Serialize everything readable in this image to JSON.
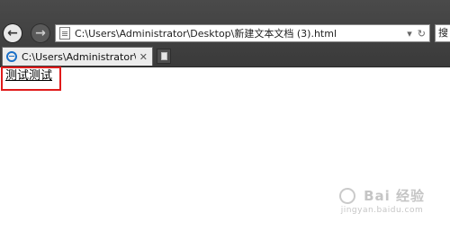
{
  "browser": {
    "address": "C:\\Users\\Administrator\\Desktop\\新建文本文档 (3).html",
    "address_icons": {
      "dropdown": "▾",
      "refresh": "↻"
    },
    "search_text": "搜",
    "back_icon": "←",
    "forward_icon": "→"
  },
  "tab": {
    "label": "C:\\Users\\Administrator\\...",
    "close": "✕"
  },
  "page": {
    "link_text": "测试测试",
    "highlight_color": "#e01b1b"
  },
  "watermark": {
    "brand": "Bai 经验",
    "url": "jingyan.baidu.com"
  }
}
